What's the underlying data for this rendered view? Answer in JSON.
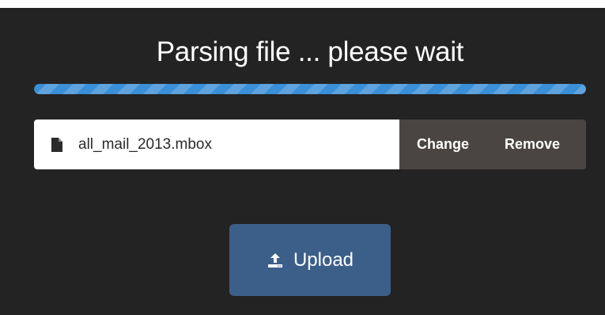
{
  "status": {
    "title": "Parsing file ... please wait",
    "progress_percent": 100
  },
  "file": {
    "icon": "file-icon",
    "name": "all_mail_2013.mbox",
    "change_label": "Change",
    "remove_label": "Remove"
  },
  "upload": {
    "icon": "upload-icon",
    "label": "Upload"
  },
  "colors": {
    "panel_bg": "#232323",
    "progress": "#3a8fd6",
    "actions_bg": "#4a4542",
    "upload_bg": "#3c5f8a"
  }
}
